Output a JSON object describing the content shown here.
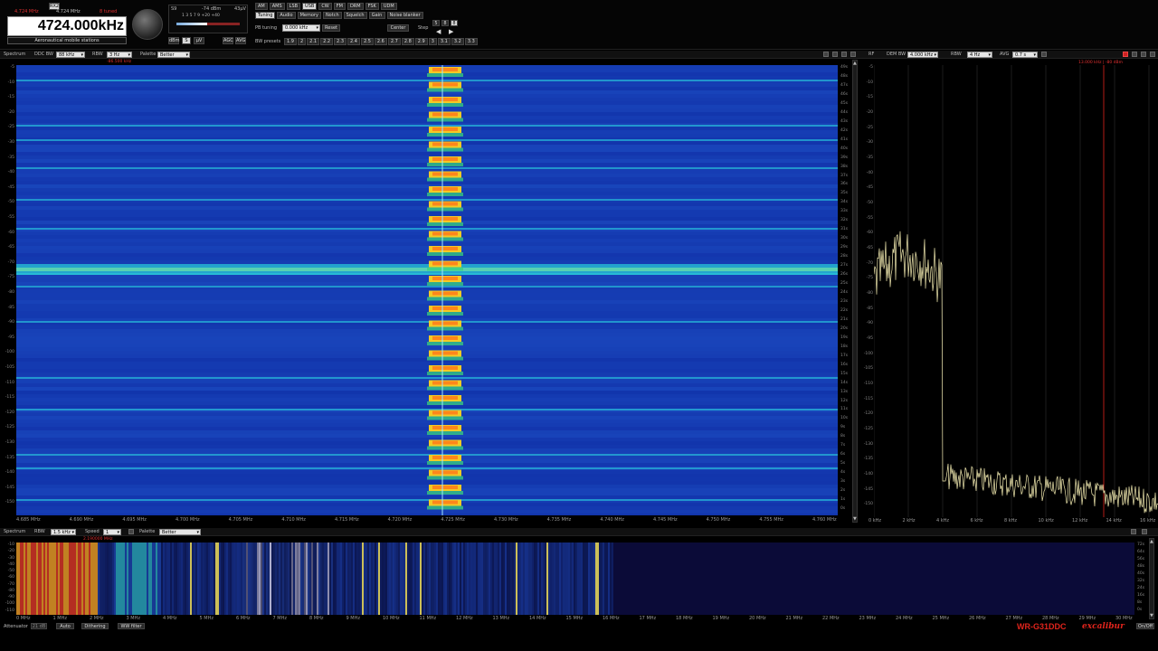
{
  "radio": {
    "channel": "RX2",
    "small_freq_red": "4.724 MHz",
    "small_freq_white": "4.724 MHz",
    "small_freq_alt": "8 tuned",
    "frequency": "4724.000kHz",
    "station": "Aeronautical mobile stations"
  },
  "signal": {
    "s_label": "S9",
    "dbm": "-74 dBm",
    "uv": "43µV",
    "scale": "1 3 5 7 9 +20 +40",
    "buttons": [
      "dBm",
      "S",
      "µV"
    ],
    "agc_buttons": [
      "AGC",
      "AVG"
    ]
  },
  "modes": [
    "AM",
    "AMS",
    "LSB",
    "USB",
    "CW",
    "FM",
    "DRM",
    "FSK",
    "UDM"
  ],
  "active_mode": "USB",
  "tabs": [
    "Tuning",
    "Audio",
    "Memory",
    "Notch",
    "Squelch",
    "Gain",
    "Noise blanker"
  ],
  "active_tab": "Tuning",
  "tuning": {
    "pb_label": "PB tuning",
    "pb_value": "0.000 kHz",
    "reset": "Reset",
    "center": "Center",
    "step_label": "Step",
    "bw_label": "BW presets",
    "bw_presets": [
      "1.9",
      "2",
      "2.1",
      "2.2",
      "2.3",
      "2.4",
      "2.5",
      "2.6",
      "2.7",
      "2.8",
      "2.9",
      "3",
      "3.1",
      "3.2",
      "3.3"
    ]
  },
  "spectrum_bar": {
    "label": "Spectrum",
    "ddc_bw_label": "DDC BW",
    "ddc_bw": "88 kHz",
    "rbw_label": "RBW",
    "rbw": "3 Hz",
    "palette_label": "Palette",
    "palette": "Better"
  },
  "right_bar": {
    "label": "RF",
    "dem_bw_label": "DEM BW",
    "dem_bw": "4.000 kHz",
    "rbw_label": "RBW",
    "rbw": "4 Hz",
    "avg_label": "AVG",
    "avg": "0.7 s",
    "marker": "13.000 kHz | -80 dBm"
  },
  "waterfall_marker": "-86.500 kHz",
  "waterfall_y_ticks": [
    "-5",
    "-10",
    "-15",
    "-20",
    "-25",
    "-30",
    "-35",
    "-40",
    "-45",
    "-50",
    "-55",
    "-60",
    "-65",
    "-70",
    "-75",
    "-80",
    "-85",
    "-90",
    "-95",
    "-100",
    "-105",
    "-110",
    "-115",
    "-120",
    "-125",
    "-130",
    "-135",
    "-140",
    "-145",
    "-150"
  ],
  "waterfall_time_ticks": [
    "49s",
    "48s",
    "47s",
    "46s",
    "45s",
    "44s",
    "43s",
    "42s",
    "41s",
    "40s",
    "39s",
    "38s",
    "37s",
    "36s",
    "35s",
    "34s",
    "33s",
    "32s",
    "31s",
    "30s",
    "29s",
    "28s",
    "27s",
    "26s",
    "25s",
    "24s",
    "23s",
    "22s",
    "21s",
    "20s",
    "19s",
    "18s",
    "17s",
    "16s",
    "15s",
    "14s",
    "13s",
    "12s",
    "11s",
    "10s",
    "9s",
    "8s",
    "7s",
    "6s",
    "5s",
    "4s",
    "3s",
    "2s",
    "1s",
    "0s"
  ],
  "waterfall_x_ticks": [
    "4.685 MHz",
    "4.690 MHz",
    "4.695 MHz",
    "4.700 MHz",
    "4.705 MHz",
    "4.710 MHz",
    "4.715 MHz",
    "4.720 MHz",
    "4.725 MHz",
    "4.730 MHz",
    "4.735 MHz",
    "4.740 MHz",
    "4.745 MHz",
    "4.750 MHz",
    "4.755 MHz",
    "4.760 MHz"
  ],
  "right_y_ticks": [
    "-5",
    "-10",
    "-15",
    "-20",
    "-25",
    "-30",
    "-35",
    "-40",
    "-45",
    "-50",
    "-55",
    "-60",
    "-65",
    "-70",
    "-75",
    "-80",
    "-85",
    "-90",
    "-95",
    "-100",
    "-105",
    "-110",
    "-115",
    "-120",
    "-125",
    "-130",
    "-135",
    "-140",
    "-145",
    "-150"
  ],
  "right_x_ticks": [
    "0 kHz",
    "2 kHz",
    "4 kHz",
    "6 kHz",
    "8 kHz",
    "10 kHz",
    "12 kHz",
    "14 kHz",
    "16 kHz"
  ],
  "band_bar": {
    "label": "Spectrum",
    "rbw_label": "RBW",
    "rbw": "1.5 kHz",
    "speed_label": "Speed",
    "speed": "1",
    "palette_label": "Palette",
    "palette": "Better",
    "marker": "2.190000 MHz"
  },
  "band_y_ticks": [
    "-10",
    "-20",
    "-30",
    "-40",
    "-50",
    "-60",
    "-70",
    "-80",
    "-90",
    "-100",
    "-110"
  ],
  "band_time_ticks": [
    "72s",
    "64s",
    "56s",
    "48s",
    "40s",
    "32s",
    "24s",
    "16s",
    "8s",
    "0s"
  ],
  "band_x_ticks": [
    "0 MHz",
    "1 MHz",
    "2 MHz",
    "3 MHz",
    "4 MHz",
    "5 MHz",
    "6 MHz",
    "7 MHz",
    "8 MHz",
    "9 MHz",
    "10 MHz",
    "11 MHz",
    "12 MHz",
    "13 MHz",
    "14 MHz",
    "15 MHz",
    "16 MHz",
    "17 MHz",
    "18 MHz",
    "19 MHz",
    "20 MHz",
    "21 MHz",
    "22 MHz",
    "23 MHz",
    "24 MHz",
    "25 MHz",
    "26 MHz",
    "27 MHz",
    "28 MHz",
    "29 MHz",
    "30 MHz"
  ],
  "bottom": {
    "attenuator_label": "Attenuator",
    "attenuator": "21 dB",
    "buttons": [
      "Auto",
      "Dithering",
      "WW filter"
    ],
    "brand": "WR-G31DDC",
    "brand_script": "excalibur",
    "on_off": "On/Off"
  },
  "colors": {
    "wf_bg": "#1030a8",
    "wf_line": "#2ad0e0",
    "wf_signal": "#ffd21e",
    "spectrum_trace": "#f2eab0",
    "brand": "#e0241c",
    "marker": "#e0241c"
  }
}
